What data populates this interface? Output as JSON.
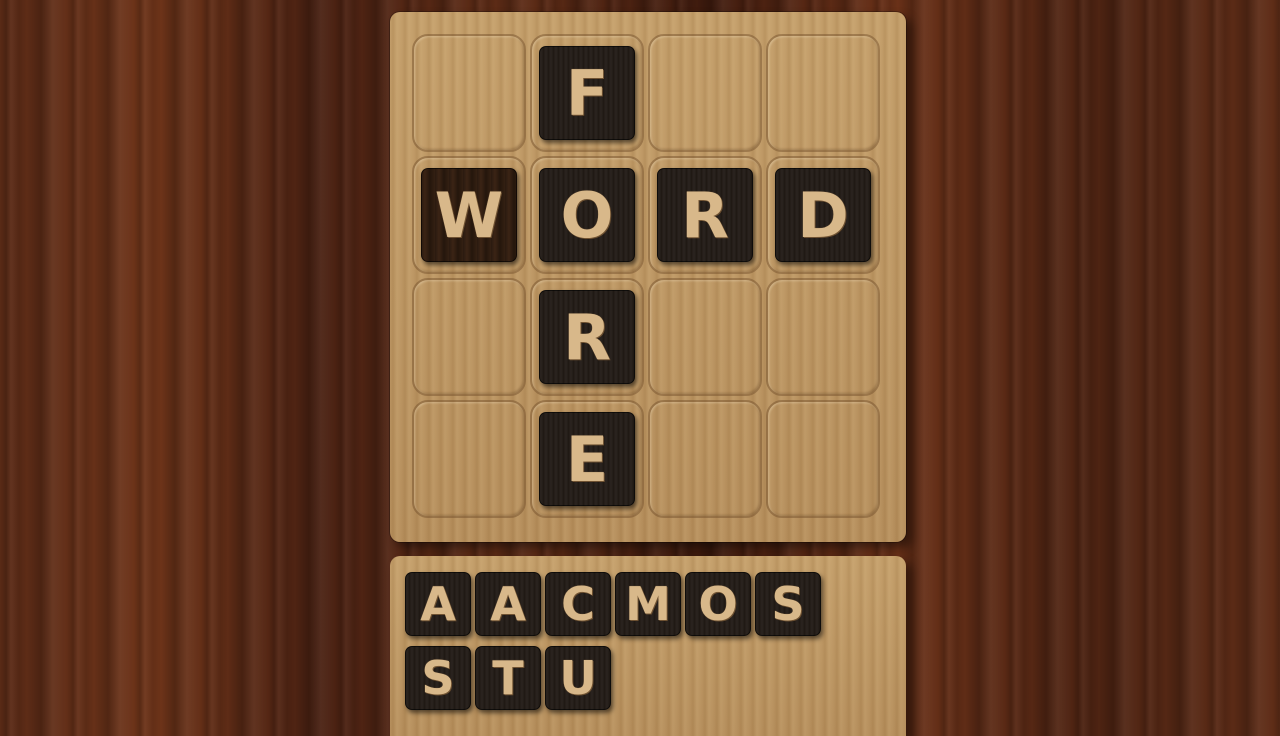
{
  "board": {
    "rows": 4,
    "cols": 4,
    "placed_tiles": [
      {
        "row": 0,
        "col": 1,
        "letter": "F"
      },
      {
        "row": 1,
        "col": 0,
        "letter": "W"
      },
      {
        "row": 1,
        "col": 1,
        "letter": "O"
      },
      {
        "row": 1,
        "col": 2,
        "letter": "R"
      },
      {
        "row": 1,
        "col": 3,
        "letter": "D"
      },
      {
        "row": 2,
        "col": 1,
        "letter": "R"
      },
      {
        "row": 3,
        "col": 1,
        "letter": "E"
      }
    ]
  },
  "tray": {
    "letters": [
      "A",
      "A",
      "C",
      "M",
      "O",
      "S",
      "S",
      "T",
      "U"
    ]
  }
}
